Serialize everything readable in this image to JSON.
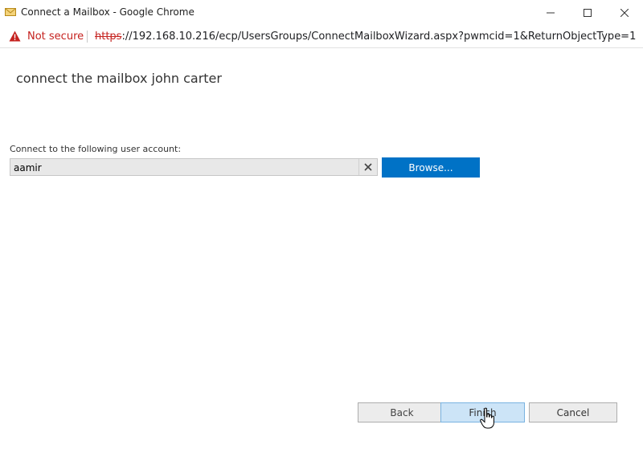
{
  "window": {
    "title": "Connect a Mailbox - Google Chrome"
  },
  "addressbar": {
    "security_label": "Not secure",
    "url_scheme": "https",
    "url_rest": "://192.168.10.216/ecp/UsersGroups/ConnectMailboxWizard.aspx?pwmcid=1&ReturnObjectType=1"
  },
  "page": {
    "title": "connect the mailbox john carter",
    "field_label": "Connect to the following user account:",
    "user_value": "aamir",
    "browse_label": "Browse..."
  },
  "footer": {
    "back_label": "Back",
    "finish_label": "Finish",
    "cancel_label": "Cancel"
  },
  "icons": {
    "title": "mail-envelope-icon",
    "warning": "warning-triangle-icon",
    "clear": "close-x-icon",
    "cursor": "hand-pointer-icon"
  },
  "colors": {
    "accent": "#0072c6",
    "insecure": "#c5221f",
    "finish_highlight": "#cce4f7"
  }
}
